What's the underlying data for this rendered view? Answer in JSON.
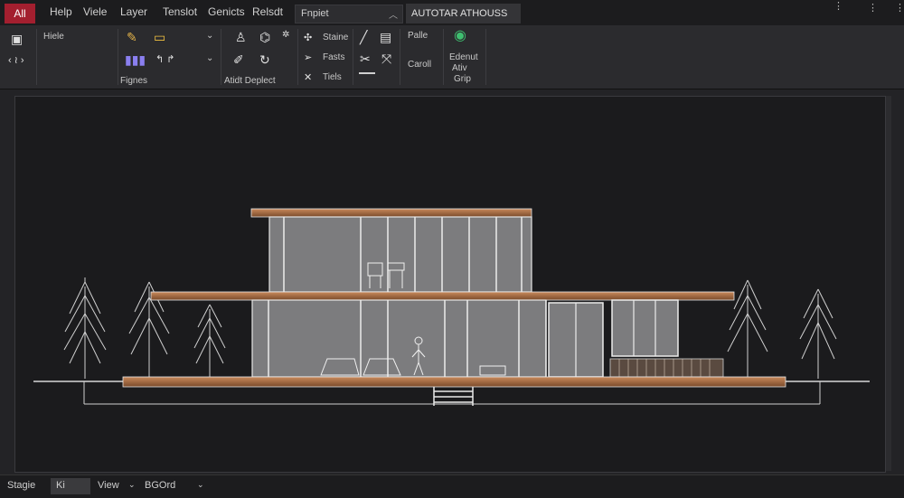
{
  "menubar": {
    "all_tab": "All",
    "items": [
      "Help",
      "Viele",
      "Layer",
      "Tenslot",
      "Genicts",
      "Relsdt"
    ],
    "search_value": "Fnpiet",
    "title_tab": "AUTOTAR  ATHOUSS"
  },
  "ribbon": {
    "panel1_label": "Hiele",
    "panel2_label": "Fignes",
    "panel3_label": "Atidt Deplect",
    "panel4_items": [
      "Staine",
      "Fasts",
      "Tiels"
    ],
    "panel6_top": "Palle",
    "panel6_bottom": "Caroll",
    "panel7_lines": [
      "Edenut",
      "Ativ",
      "Grip"
    ]
  },
  "status": {
    "item1": "Stagie",
    "item2": "Ki",
    "item3": "View",
    "item4": "BGOrd"
  }
}
